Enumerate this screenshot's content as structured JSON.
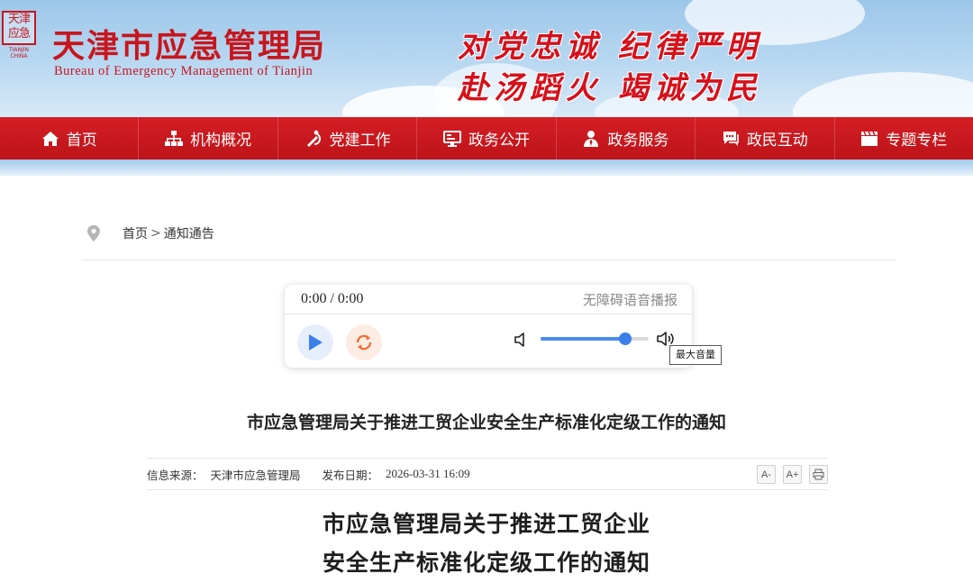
{
  "header": {
    "logo_seal_text": "天津 应急",
    "logo_seal_sub": "TIANJIN CHINA",
    "title": "天津市应急管理局",
    "subtitle": "Bureau of Emergency Management of Tianjin",
    "slogan_line1": "对党忠诚 纪律严明",
    "slogan_line2": "赴汤蹈火 竭诚为民",
    "brand_color": "#c8161d"
  },
  "nav": {
    "items": [
      {
        "label": "首页",
        "icon": "home-icon"
      },
      {
        "label": "机构概况",
        "icon": "org-chart-icon"
      },
      {
        "label": "党建工作",
        "icon": "party-emblem-icon"
      },
      {
        "label": "政务公开",
        "icon": "monitor-icon"
      },
      {
        "label": "政务服务",
        "icon": "person-service-icon"
      },
      {
        "label": "政民互动",
        "icon": "chat-icon"
      },
      {
        "label": "专题专栏",
        "icon": "clapper-icon"
      }
    ]
  },
  "breadcrumb": {
    "home": "首页",
    "separator": ">",
    "current": "通知通告"
  },
  "player": {
    "time": "0:00 / 0:00",
    "label": "无障碍语音播报",
    "volume": 0.78,
    "tooltip": "最大音量",
    "accent_color": "#3b7fea",
    "loop_color": "#f26b2c"
  },
  "article": {
    "title": "市应急管理局关于推进工贸企业安全生产标准化定级工作的通知",
    "source_label": "信息来源：",
    "source": "天津市应急管理局",
    "date_label": "发布日期：",
    "date": "2026-03-31 16:09",
    "font_smaller": "A-",
    "font_larger": "A+",
    "print_icon": "print-icon",
    "doc_title_line1": "市应急管理局关于推进工贸企业",
    "doc_title_line2": "安全生产标准化定级工作的通知"
  }
}
